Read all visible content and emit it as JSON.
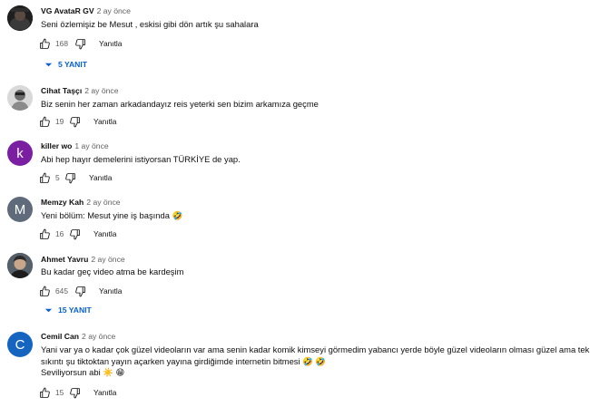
{
  "comments": [
    {
      "author": "VG AvataR GV",
      "time": "2 ay önce",
      "text": [
        "Seni özlemişiz be Mesut , eskisi gibi dön artık şu sahalara"
      ],
      "likes": "168",
      "reply_label": "Yanıtla",
      "replies": "5 YANIT",
      "avatar_icon": "avatar-photo-icon"
    },
    {
      "author": "Cihat Taşçı",
      "time": "2 ay önce",
      "text": [
        "Biz senin her zaman arkadandayız reis yeterki sen bizim arkamıza geçme"
      ],
      "likes": "19",
      "reply_label": "Yanıtla",
      "avatar_icon": "avatar-photo-icon"
    },
    {
      "author": "killer wo",
      "time": "1 ay önce",
      "text": [
        "Abi hep hayır demelerini istiyorsan TÜRKİYE de yap."
      ],
      "likes": "5",
      "reply_label": "Yanıtla",
      "avatar_letter": "k",
      "avatar_color": "#7b1fa2"
    },
    {
      "author": "Memzy Kah",
      "time": "2 ay önce",
      "text": [
        "Yeni bölüm: Mesut yine iş başında 🤣"
      ],
      "likes": "16",
      "reply_label": "Yanıtla",
      "avatar_letter": "M",
      "avatar_color": "#5f6b7a"
    },
    {
      "author": "Ahmet Yavru",
      "time": "2 ay önce",
      "text": [
        "Bu kadar geç video atma be kardeşim"
      ],
      "likes": "645",
      "reply_label": "Yanıtla",
      "replies": "15 YANIT",
      "avatar_icon": "avatar-photo-icon"
    },
    {
      "author": "Cemil Can",
      "time": "2 ay önce",
      "text": [
        "Yani var ya o kadar çok güzel videoların var ama senin kadar komik kimseyi görmedim yabancı yerde    böyle güzel videoların olması güzel ama tek",
        "sıkıntı şu tiktoktan yayın açarken yayına girdiğimde internetin bitmesi 🤣 🤣",
        "Seviliyorsun abi ☀️ 😁"
      ],
      "likes": "15",
      "reply_label": "Yanıtla",
      "avatar_letter": "C",
      "avatar_color": "#1565c0"
    }
  ],
  "icons": {
    "like": "thumb-up-icon",
    "dislike": "thumb-down-icon",
    "expand": "caret-down-icon"
  },
  "colors": {
    "link_blue": "#065fd4",
    "meta_gray": "#606060",
    "text": "#0f0f0f"
  }
}
